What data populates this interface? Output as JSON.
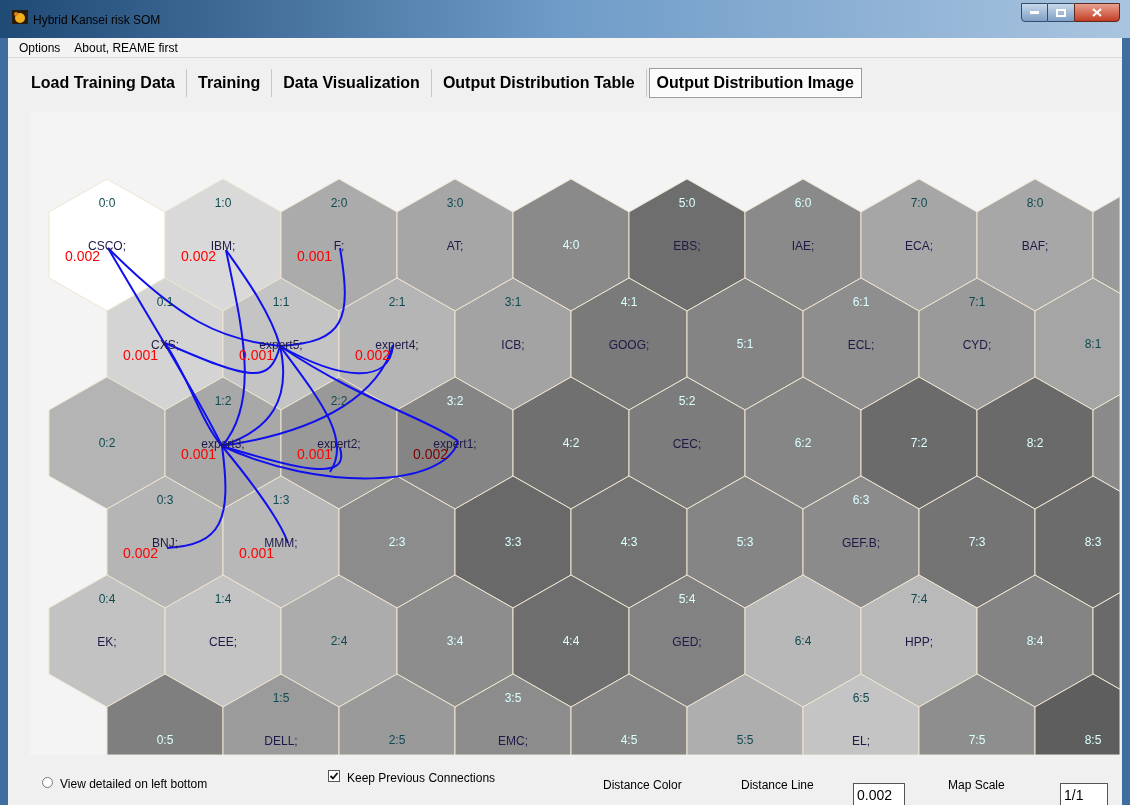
{
  "window": {
    "title": "Hybrid Kansei risk SOM"
  },
  "menu": [
    {
      "label": "Options"
    },
    {
      "label": "About, REAME first"
    }
  ],
  "tabs": [
    {
      "label": "Load Training Data",
      "selected": false
    },
    {
      "label": "Training",
      "selected": false
    },
    {
      "label": "Data Visualization",
      "selected": false
    },
    {
      "label": "Output Distribution Table",
      "selected": false
    },
    {
      "label": "Output Distribution Image",
      "selected": true
    }
  ],
  "map": {
    "rows": [
      [
        {
          "coord": "0:0",
          "name": "CSCO;",
          "distance": "0.002",
          "color": "#ffffff"
        },
        {
          "coord": "1:0",
          "name": "IBM;",
          "distance": "0.002",
          "color": "#d9d9d9"
        },
        {
          "coord": "2:0",
          "name": "F;",
          "distance": "0.001",
          "color": "#ababab"
        },
        {
          "coord": "3:0",
          "name": "AT;",
          "color": "#a6a6a6"
        },
        {
          "coord": "4:0",
          "color": "#8a8a8a"
        },
        {
          "coord": "5:0",
          "name": "EBS;",
          "color": "#6e6e6e"
        },
        {
          "coord": "6:0",
          "name": "IAE;",
          "color": "#8a8a8a"
        },
        {
          "coord": "7:0",
          "name": "ECA;",
          "color": "#a6a6a6"
        },
        {
          "coord": "8:0",
          "name": "BAF;",
          "color": "#a7a7a7"
        },
        {
          "color": "#9a9a9a"
        }
      ],
      [
        {
          "coord": "0:1",
          "name": "CXS;",
          "distance": "0.001",
          "color": "#d4d4d4"
        },
        {
          "coord": "1:1",
          "name": "expert5;",
          "distance": "0.001",
          "color": "#c4c4c4"
        },
        {
          "coord": "2:1",
          "name": "expert4;",
          "distance": "0.002",
          "color": "#b5b5b5"
        },
        {
          "coord": "3:1",
          "name": "ICB;",
          "color": "#a3a3a3"
        },
        {
          "coord": "4:1",
          "name": "GOOG;",
          "color": "#7a7a7a"
        },
        {
          "coord": "5:1",
          "color": "#848484"
        },
        {
          "coord": "6:1",
          "name": "ECL;",
          "color": "#8e8e8e"
        },
        {
          "coord": "7:1",
          "name": "CYD;",
          "color": "#9a9a9a"
        },
        {
          "coord": "8:1",
          "color": "#a5a5a5"
        }
      ],
      [
        {
          "coord": "0:2",
          "color": "#b4b4b4"
        },
        {
          "coord": "1:2",
          "name": "expert3;",
          "distance": "0.001",
          "color": "#a8a8a8"
        },
        {
          "coord": "2:2",
          "name": "expert2;",
          "distance": "0.001",
          "color": "#999999"
        },
        {
          "coord": "3:2",
          "name": "expert1;",
          "distance": "0.002",
          "color": "#858585"
        },
        {
          "coord": "4:2",
          "color": "#707070"
        },
        {
          "coord": "5:2",
          "name": "CEC;",
          "color": "#7c7c7c"
        },
        {
          "coord": "6:2",
          "color": "#868686"
        },
        {
          "coord": "7:2",
          "color": "#6b6b6b"
        },
        {
          "coord": "8:2",
          "color": "#6a6a6a"
        },
        {
          "color": "#8a8a8a"
        }
      ],
      [
        {
          "coord": "0:3",
          "name": "BNJ;",
          "distance": "0.002",
          "color": "#b5b5b5"
        },
        {
          "coord": "1:3",
          "name": "MMM;",
          "distance": "0.001",
          "color": "#b8b8b8"
        },
        {
          "coord": "2:3",
          "color": "#8c8c8c"
        },
        {
          "coord": "3:3",
          "color": "#696969"
        },
        {
          "coord": "4:3",
          "color": "#737373"
        },
        {
          "coord": "5:3",
          "color": "#858585"
        },
        {
          "coord": "6:3",
          "name": "GEF.B;",
          "color": "#8b8b8b"
        },
        {
          "coord": "7:3",
          "color": "#747474"
        },
        {
          "coord": "8:3",
          "color": "#6c6c6c"
        }
      ],
      [
        {
          "coord": "0:4",
          "name": "EK;",
          "color": "#c2c2c2"
        },
        {
          "coord": "1:4",
          "name": "CEE;",
          "color": "#c4c4c4"
        },
        {
          "coord": "2:4",
          "color": "#acacac"
        },
        {
          "coord": "3:4",
          "color": "#8d8d8d"
        },
        {
          "coord": "4:4",
          "color": "#6e6e6e"
        },
        {
          "coord": "5:4",
          "name": "GED;",
          "color": "#828282"
        },
        {
          "coord": "6:4",
          "color": "#b8b8b8"
        },
        {
          "coord": "7:4",
          "name": "HPP;",
          "color": "#b9b9b9"
        },
        {
          "coord": "8:4",
          "color": "#848484"
        },
        {
          "color": "#6a6a6a"
        }
      ],
      [
        {
          "coord": "0:5",
          "color": "#7f7f7f"
        },
        {
          "coord": "1:5",
          "name": "DELL;",
          "color": "#9b9b9b"
        },
        {
          "coord": "2:5",
          "color": "#9a9a9a"
        },
        {
          "coord": "3:5",
          "name": "EMC;",
          "color": "#8c8c8c"
        },
        {
          "coord": "4:5",
          "color": "#858585"
        },
        {
          "coord": "5:5",
          "color": "#aeaeae"
        },
        {
          "coord": "6:5",
          "name": "EL;",
          "color": "#c4c4c4"
        },
        {
          "coord": "7:5",
          "color": "#8e8e8e"
        },
        {
          "coord": "8:5",
          "color": "#5e5e5e"
        }
      ]
    ]
  },
  "controls": {
    "view_detailed": {
      "label": "View detailed on left bottom",
      "selected": false
    },
    "keep_connections": {
      "label": "Keep Previous Connections",
      "checked": true
    },
    "distance_color": {
      "label": "Distance Color"
    },
    "distance_line": {
      "label": "Distance Line",
      "value": "0.002"
    },
    "map_scale": {
      "label": "Map Scale",
      "value": "1/1"
    }
  }
}
